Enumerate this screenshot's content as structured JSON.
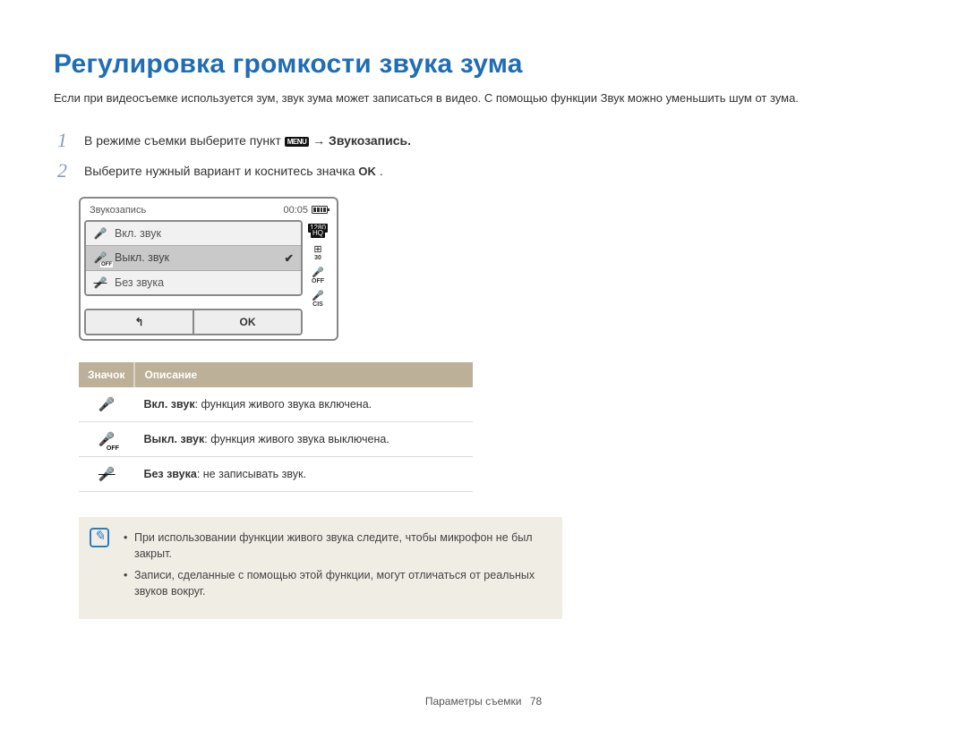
{
  "title": "Регулировка громкости звука зума",
  "intro": "Если при видеосъемке используется зум, звук зума может записаться в видео. С помощью функции Звук можно уменьшить шум от зума.",
  "step1_pre": "В режиме съемки выберите пункт ",
  "step1_menu": "MENU",
  "step1_post": " → Звукозапись.",
  "step2_pre": "Выберите нужный вариант и коснитесь значка ",
  "step2_ok": "OK",
  "step2_post": " .",
  "camera": {
    "title": "Звукозапись",
    "time": "00:05",
    "res_top": "1280",
    "res_bot": "HQ",
    "fps": "30",
    "off": "OFF",
    "cis": "CIS",
    "opt1": "Вкл. звук",
    "opt2": "Выкл. звук",
    "opt3": "Без звука",
    "back": "↰",
    "ok": "OK"
  },
  "table": {
    "h1": "Значок",
    "h2": "Описание",
    "r1b": "Вкл. звук",
    "r1t": ": функция живого звука включена.",
    "r2b": "Выкл. звук",
    "r2t": ": функция живого звука выключена.",
    "r3b": "Без звука",
    "r3t": ": не записывать звук."
  },
  "notes": {
    "n1": "При использовании функции живого звука следите, чтобы микрофон не был закрыт.",
    "n2": "Записи, сделанные с помощью этой функции, могут отличаться от реальных звуков вокруг."
  },
  "footer_section": "Параметры съемки ",
  "footer_page": "78"
}
